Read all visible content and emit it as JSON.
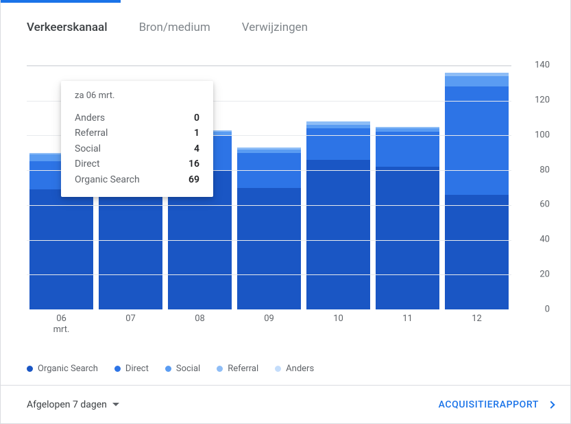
{
  "tabs": {
    "items": [
      {
        "label": "Verkeerskanaal",
        "active": true
      },
      {
        "label": "Bron/medium",
        "active": false
      },
      {
        "label": "Verwijzingen",
        "active": false
      }
    ]
  },
  "footer": {
    "date_range_label": "Afgelopen 7 dagen",
    "report_link_label": "ACQUISITIERAPPORT"
  },
  "tooltip": {
    "title": "za 06 mrt.",
    "rows": [
      {
        "label": "Anders",
        "value": "0"
      },
      {
        "label": "Referral",
        "value": "1"
      },
      {
        "label": "Social",
        "value": "4"
      },
      {
        "label": "Direct",
        "value": "16"
      },
      {
        "label": "Organic Search",
        "value": "69"
      }
    ]
  },
  "legend": {
    "items": [
      {
        "label": "Organic Search",
        "color": "#1a56c4"
      },
      {
        "label": "Direct",
        "color": "#2d74e6"
      },
      {
        "label": "Social",
        "color": "#5a9cf2"
      },
      {
        "label": "Referral",
        "color": "#8ebdf6"
      },
      {
        "label": "Anders",
        "color": "#c4ddfb"
      }
    ]
  },
  "colors": {
    "organic_search": "#1a56c4",
    "direct": "#2d74e6",
    "social": "#5a9cf2",
    "referral": "#8ebdf6",
    "anders": "#c4ddfb"
  },
  "chart_data": {
    "type": "bar",
    "stacked": true,
    "title": "",
    "xlabel": "",
    "ylabel": "",
    "ylim": [
      0,
      140
    ],
    "y_ticks": [
      0,
      20,
      40,
      60,
      80,
      100,
      120,
      140
    ],
    "x_labels": [
      "06\nmrt.",
      "07",
      "08",
      "09",
      "10",
      "11",
      "12"
    ],
    "categories": [
      "06 mrt.",
      "07",
      "08",
      "09",
      "10",
      "11",
      "12"
    ],
    "series": [
      {
        "name": "Organic Search",
        "color": "#1a56c4",
        "values": [
          69,
          68,
          80,
          70,
          86,
          82,
          66
        ]
      },
      {
        "name": "Direct",
        "color": "#2d74e6",
        "values": [
          16,
          21,
          20,
          20,
          18,
          20,
          62
        ]
      },
      {
        "name": "Social",
        "color": "#5a9cf2",
        "values": [
          4,
          3,
          2,
          2,
          2,
          2,
          6
        ]
      },
      {
        "name": "Referral",
        "color": "#8ebdf6",
        "values": [
          1,
          1,
          1,
          1,
          2,
          1,
          2
        ]
      },
      {
        "name": "Anders",
        "color": "#c4ddfb",
        "values": [
          0,
          0,
          0,
          0,
          0,
          0,
          0
        ]
      }
    ]
  }
}
